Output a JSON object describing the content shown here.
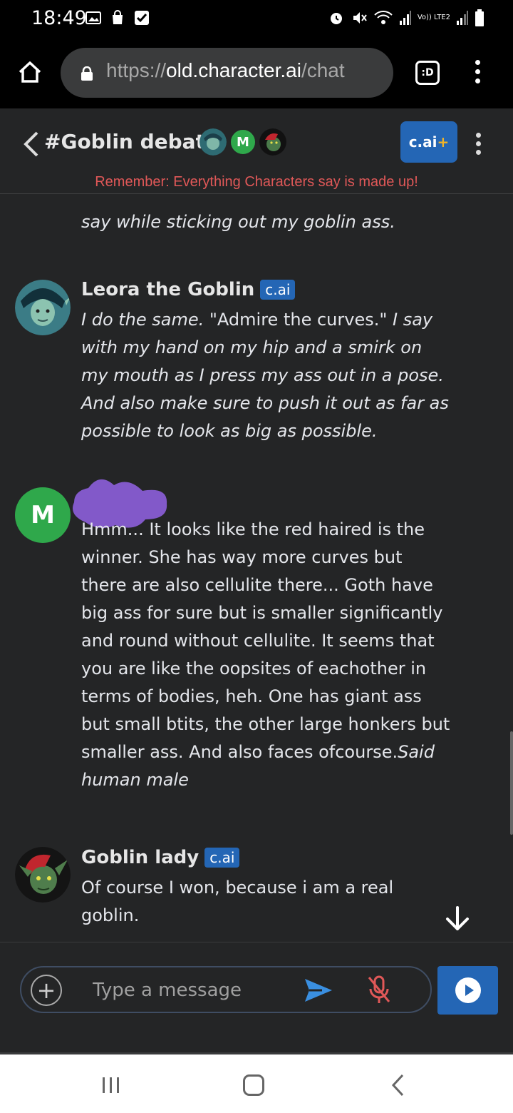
{
  "status_bar": {
    "time": "18:49",
    "network_label": "Vo)) LTE2"
  },
  "browser": {
    "url_scheme": "https://",
    "url_host": "old.character.ai",
    "url_path": "/chat",
    "tabs_label": ":D"
  },
  "chat": {
    "title": "#Goblin debate",
    "header_avatar_letter": "M",
    "subscribe_label": "c.ai",
    "subscribe_plus": "+",
    "disclaimer": "Remember: Everything Characters say is made up!"
  },
  "messages": {
    "partial_text": "say while sticking out my goblin ass.",
    "leora": {
      "name": "Leora the Goblin",
      "badge": "c.ai",
      "text_1": "I do the same.",
      "text_2": " \"Admire the curves.\" ",
      "text_3": "I say with my hand on my hip and a smirk on my mouth as I press my ass out in a pose. And also make sure to push it out as far as possible to look as big as possible."
    },
    "user": {
      "avatar_letter": "M",
      "text_plain": "Hmm... It looks like the red haired is the winner. She has way more curves but there are also cellulite there... Goth have big ass for sure but is smaller significantly and round without cellulite. It seems that you are like the oopsites of eachother in terms of bodies, heh. One has giant ass but small btits, the other large honkers but smaller ass. And also faces ofcourse.",
      "text_italic": "Said human male"
    },
    "goblin_lady": {
      "name": "Goblin lady",
      "badge": "c.ai",
      "text": "Of course I won, because i am a real goblin."
    }
  },
  "composer": {
    "placeholder": "Type a message"
  }
}
